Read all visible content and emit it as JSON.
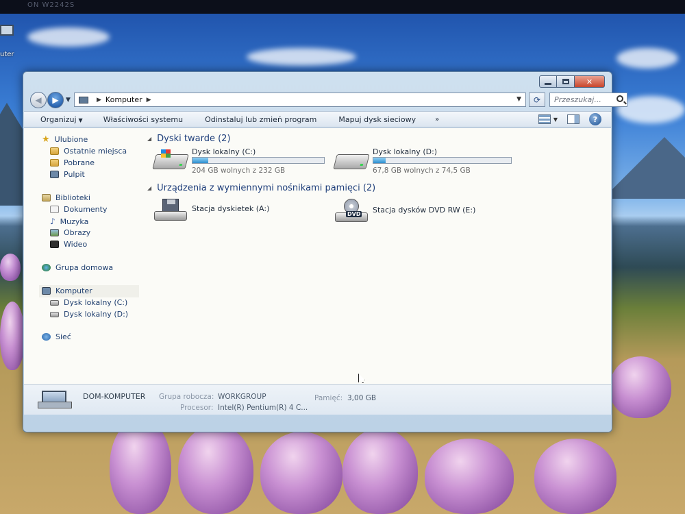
{
  "monitor": {
    "label": "ON W2242S"
  },
  "desktop": {
    "icons": [
      {
        "label": "uter",
        "icon": "computer-icon"
      }
    ]
  },
  "window": {
    "address": {
      "crumb": "Komputer"
    },
    "search": {
      "placeholder": "Przeszukaj..."
    },
    "command_bar": {
      "organize": "Organizuj",
      "items": [
        "Właściwości systemu",
        "Odinstaluj lub zmień program",
        "Mapuj dysk sieciowy"
      ],
      "more": "»"
    },
    "nav_pane": {
      "favorites": {
        "label": "Ulubione",
        "items": [
          "Ostatnie miejsca",
          "Pobrane",
          "Pulpit"
        ]
      },
      "libraries": {
        "label": "Biblioteki",
        "items": [
          "Dokumenty",
          "Muzyka",
          "Obrazy",
          "Wideo"
        ]
      },
      "homegroup": "Grupa domowa",
      "computer": {
        "label": "Komputer",
        "items": [
          "Dysk lokalny (C:)",
          "Dysk lokalny (D:)"
        ]
      },
      "network": "Sieć"
    },
    "groups": {
      "hard_drives": {
        "title": "Dyski twarde (2)",
        "drives": [
          {
            "name": "Dysk lokalny (C:)",
            "free_text": "204 GB wolnych z 232 GB",
            "used_fraction": 0.12
          },
          {
            "name": "Dysk lokalny (D:)",
            "free_text": "67,8 GB wolnych z 74,5 GB",
            "used_fraction": 0.09
          }
        ]
      },
      "removable": {
        "title": "Urządzenia z wymiennymi nośnikami pamięci (2)",
        "devices": [
          {
            "name": "Stacja dyskietek (A:)"
          },
          {
            "name": "Stacja dysków DVD RW (E:)",
            "badge": "DVD"
          }
        ]
      }
    },
    "details": {
      "computer_name": "DOM-KOMPUTER",
      "workgroup_label": "Grupa robocza:",
      "workgroup_value": "WORKGROUP",
      "memory_label": "Pamięć:",
      "memory_value": "3,00 GB",
      "processor_label": "Procesor:",
      "processor_value": "Intel(R) Pentium(R) 4 C..."
    }
  },
  "colors": {
    "accent": "#1e3e7a",
    "progress_fill": "#2e8fd0",
    "close_button": "#c9462c"
  }
}
